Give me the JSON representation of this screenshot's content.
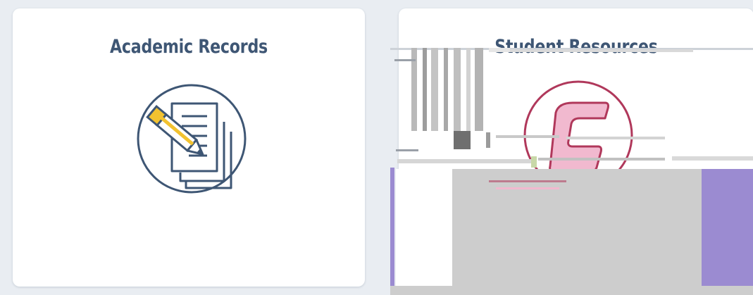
{
  "cards": [
    {
      "title": "Academic Records",
      "icon": "document-edit-icon",
      "colors": {
        "title": "#3e5674",
        "icon_stroke": "#3e5674",
        "pencil": "#f2c230"
      }
    },
    {
      "title": "Student Resources",
      "icon": "student-resources-icon",
      "colors": {
        "title": "#3e5674",
        "icon_ring": "#b0385b",
        "icon_fill": "#f1b9cf",
        "overlay_gray": "#cdcdcd",
        "overlay_purple": "#9b8bd1"
      }
    }
  ]
}
